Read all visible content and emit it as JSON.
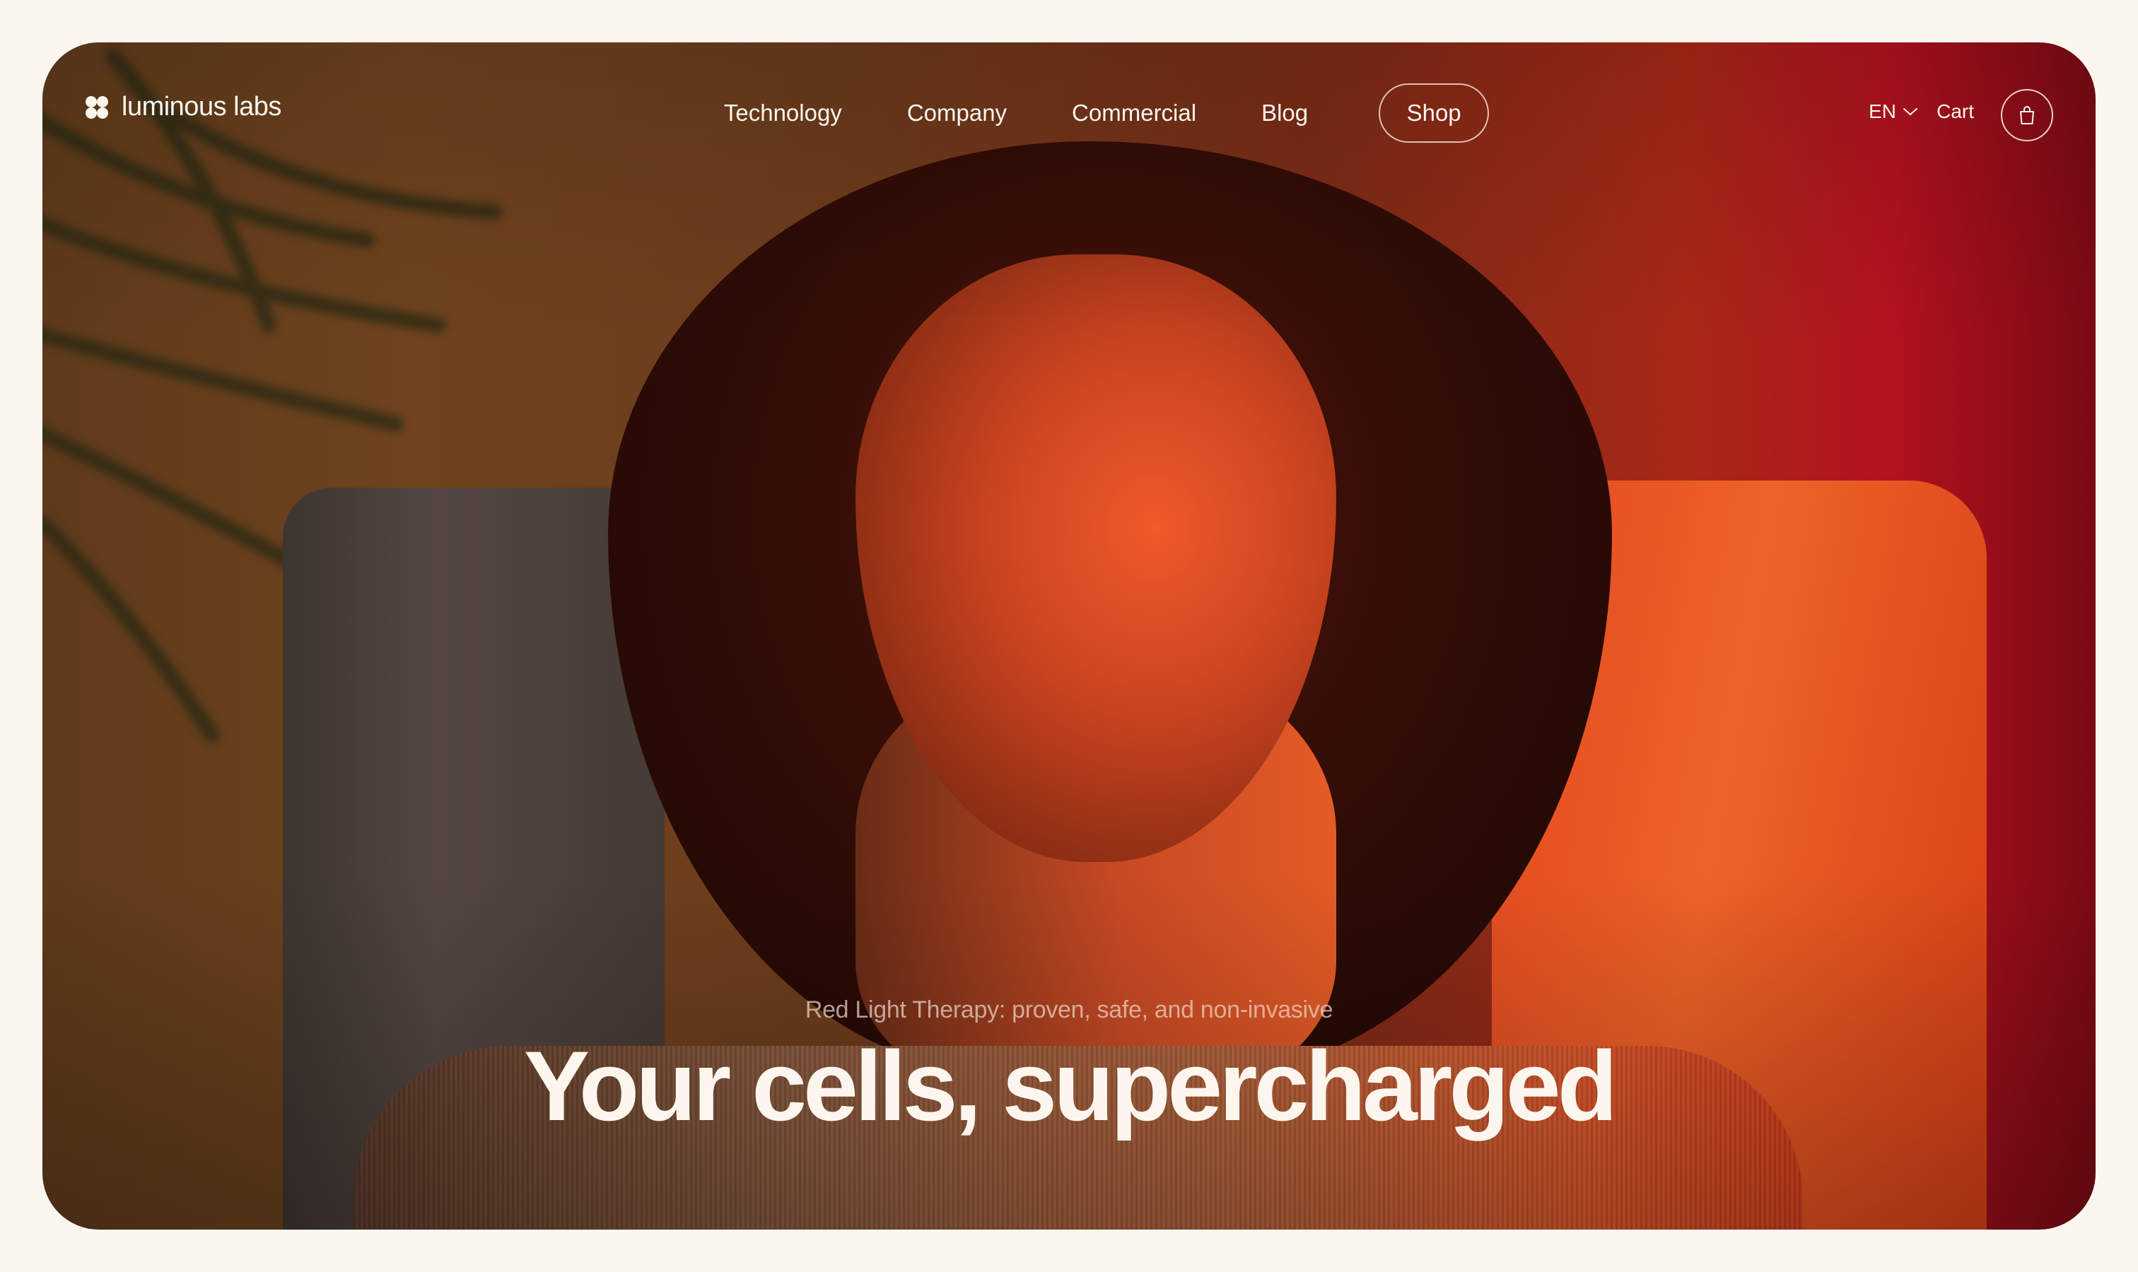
{
  "brand": {
    "name": "luminous labs",
    "logo_icon": "clover-logo-icon"
  },
  "nav": {
    "links": [
      {
        "label": "Technology"
      },
      {
        "label": "Company"
      },
      {
        "label": "Commercial"
      },
      {
        "label": "Blog"
      }
    ],
    "shop_label": "Shop"
  },
  "utility": {
    "language": "EN",
    "language_icon": "chevron-down-icon",
    "cart_label": "Cart",
    "cart_icon": "shopping-bag-icon"
  },
  "hero": {
    "subtitle": "Red Light Therapy: proven, safe, and non-invasive",
    "headline": "Your cells, supercharged"
  },
  "colors": {
    "page_background": "#fbf6f0",
    "text_light": "#fdf6ee",
    "accent_red": "#b3121f",
    "accent_orange": "#ee6228"
  }
}
